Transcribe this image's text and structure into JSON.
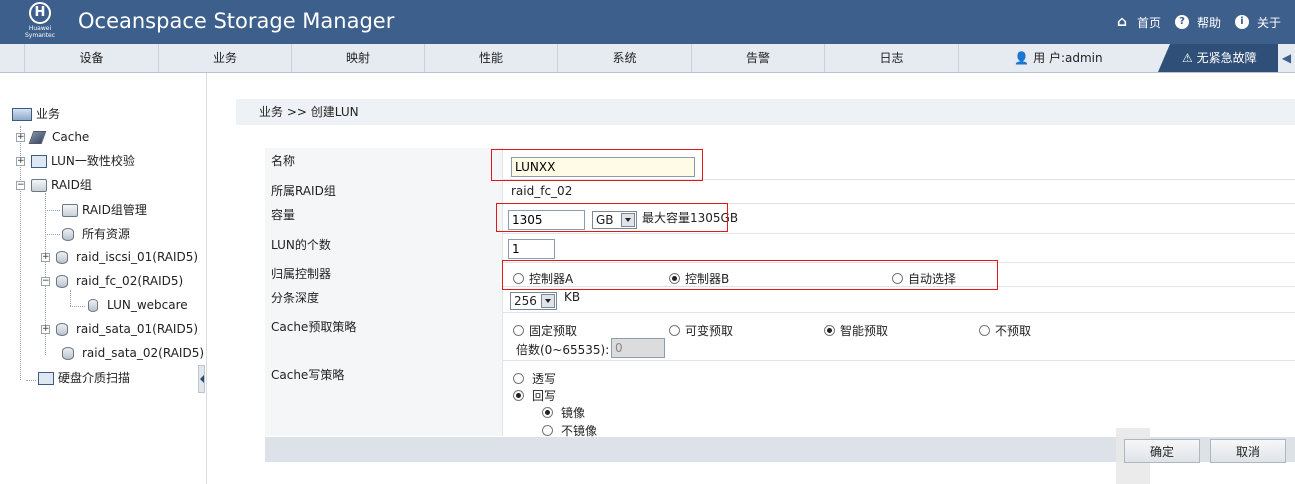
{
  "header": {
    "logo_text": "Huawei Symantec",
    "app_title": "Oceanspace Storage Manager",
    "links": [
      {
        "label": "首页",
        "icon": "home-icon"
      },
      {
        "label": "帮助",
        "icon": "help-icon"
      },
      {
        "label": "关于",
        "icon": "info-icon"
      }
    ]
  },
  "nav": {
    "items": [
      "设备",
      "业务",
      "映射",
      "性能",
      "系统",
      "告警",
      "日志"
    ],
    "user": "用 户:admin",
    "alarm": "无紧急故障"
  },
  "tree": {
    "root": "业务",
    "cache": "Cache",
    "lun_check": "LUN一致性校验",
    "raid_group": "RAID组",
    "raid_mgmt": "RAID组管理",
    "all_resources": "所有资源",
    "raid_iscsi": "raid_iscsi_01(RAID5)",
    "raid_fc": "raid_fc_02(RAID5)",
    "lun_webcare": "LUN_webcare",
    "raid_sata1": "raid_sata_01(RAID5)",
    "raid_sata2": "raid_sata_02(RAID5)",
    "disk_scan": "硬盘介质扫描"
  },
  "breadcrumb": "业务  >>  创建LUN",
  "form": {
    "name_label": "名称",
    "name_value": "LUNXX",
    "raid_label": "所属RAID组",
    "raid_value": "raid_fc_02",
    "capacity_label": "容量",
    "capacity_value": "1305",
    "capacity_unit": "GB",
    "capacity_max": "最大容量1305GB",
    "count_label": "LUN的个数",
    "count_value": "1",
    "controller_label": "归属控制器",
    "controller_options": [
      "控制器A",
      "控制器B",
      "自动选择"
    ],
    "controller_selected": "控制器B",
    "stripe_label": "分条深度",
    "stripe_value": "256",
    "stripe_unit": "KB",
    "prefetch_label": "Cache预取策略",
    "prefetch_options": [
      "固定预取",
      "可变预取",
      "智能预取",
      "不预取"
    ],
    "prefetch_selected": "智能预取",
    "multiplier_label": "倍数(0~65535):",
    "multiplier_value": "0",
    "write_label": "Cache写策略",
    "write_options": [
      "透写",
      "回写"
    ],
    "write_selected": "回写",
    "mirror_options": [
      "镜像",
      "不镜像"
    ],
    "mirror_selected": "镜像"
  },
  "buttons": {
    "ok": "确定",
    "cancel": "取消"
  }
}
